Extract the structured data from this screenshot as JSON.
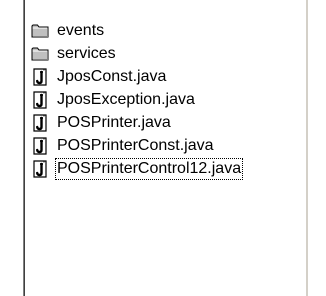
{
  "file_list": {
    "items": [
      {
        "label": "events",
        "icon": "folder-icon",
        "type": "folder"
      },
      {
        "label": "services",
        "icon": "folder-icon",
        "type": "folder"
      },
      {
        "label": "JposConst.java",
        "icon": "java-file-icon",
        "type": "file"
      },
      {
        "label": "JposException.java",
        "icon": "java-file-icon",
        "type": "file"
      },
      {
        "label": "POSPrinter.java",
        "icon": "java-file-icon",
        "type": "file"
      },
      {
        "label": "POSPrinterConst.java",
        "icon": "java-file-icon",
        "type": "file"
      },
      {
        "label": "POSPrinterControl12.java",
        "icon": "java-file-icon",
        "type": "file",
        "focused": true
      }
    ]
  },
  "colors": {
    "background": "#ffffff",
    "text": "#000000",
    "folder_fill": "#c0c0c0",
    "border_dark": "#404040",
    "border_mid": "#808080"
  }
}
